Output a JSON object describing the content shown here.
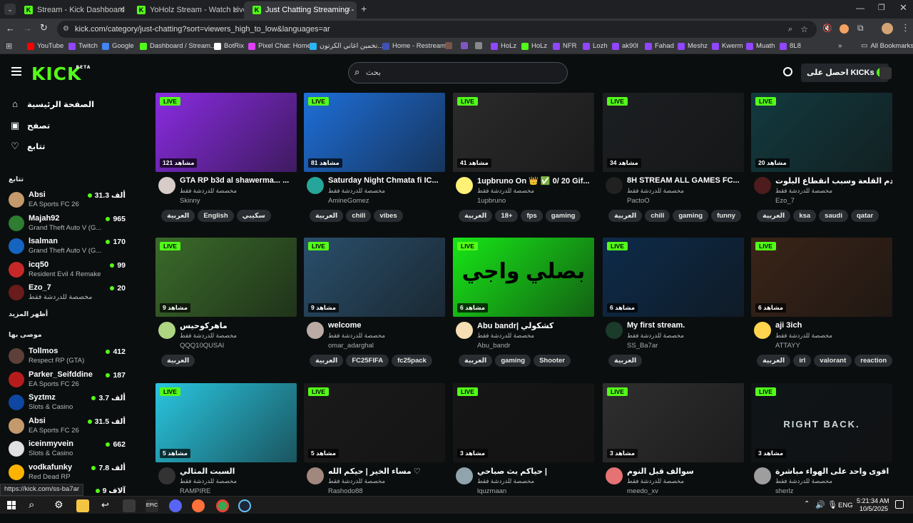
{
  "browser": {
    "tabs": [
      {
        "title": "Stream - Kick Dashboard"
      },
      {
        "title": "YoHolz Stream - Watch Live on"
      },
      {
        "title": "Just Chatting Streaming - Live"
      }
    ],
    "url": "kick.com/category/just-chatting?sort=viewers_high_to_low&languages=ar",
    "bookmarks": [
      {
        "label": "YouTube",
        "color": "#ff0000"
      },
      {
        "label": "Twitch",
        "color": "#9146ff"
      },
      {
        "label": "Google",
        "color": "#4285f4"
      },
      {
        "label": "Dashboard / Stream...",
        "color": "#53fc18"
      },
      {
        "label": "BotRix",
        "color": "#ffffff"
      },
      {
        "label": "Pixel Chat: Home",
        "color": "#e040fb"
      },
      {
        "label": "تخمين اغاني الكرتون...",
        "color": "#29b6f6"
      },
      {
        "label": "Home - Restream",
        "color": "#3f51b5"
      },
      {
        "label": "",
        "color": "#795548"
      },
      {
        "label": "",
        "color": "#7e57c2"
      },
      {
        "label": "",
        "color": "#888888"
      },
      {
        "label": "HoLz",
        "color": "#9146ff"
      },
      {
        "label": "HoLz",
        "color": "#53fc18"
      },
      {
        "label": "NFR",
        "color": "#9146ff"
      },
      {
        "label": "Lozh",
        "color": "#9146ff"
      },
      {
        "label": "ak90l",
        "color": "#9146ff"
      },
      {
        "label": "Fahad",
        "color": "#9146ff"
      },
      {
        "label": "Meshz",
        "color": "#9146ff"
      },
      {
        "label": "Kwerm",
        "color": "#9146ff"
      },
      {
        "label": "Muath",
        "color": "#9146ff"
      },
      {
        "label": "8L8",
        "color": "#9146ff"
      }
    ],
    "all_bookmarks": "All Bookmarks",
    "status_url": "https://kick.com/ss-ba7ar"
  },
  "header": {
    "logo": "KICK",
    "logo_beta": "BETA",
    "search_placeholder": "بحث",
    "get_kicks": "احصل على KICKs"
  },
  "sidebar": {
    "nav": [
      {
        "label": "الصفحة الرئيسية",
        "icon": "home-icon"
      },
      {
        "label": "تصفح",
        "icon": "browse-icon"
      },
      {
        "label": "تتابع",
        "icon": "heart-icon"
      }
    ],
    "following_title": "تتابع",
    "following": [
      {
        "name": "Absi",
        "category": "EA Sports FC 26",
        "viewers": "31.3 ألف",
        "color": "#c49a6c"
      },
      {
        "name": "Majah92",
        "category": "Grand Theft Auto V (G...",
        "viewers": "965",
        "color": "#2e7d32"
      },
      {
        "name": "lsalman",
        "category": "Grand Theft Auto V (G...",
        "viewers": "170",
        "color": "#1565c0"
      },
      {
        "name": "icq50",
        "category": "Resident Evil 4 Remake",
        "viewers": "99",
        "color": "#c62828"
      },
      {
        "name": "Ezo_7",
        "category": "مخصصة للدردشة فقط",
        "viewers": "20",
        "color": "#6a1b1b"
      }
    ],
    "show_more": "أظهر المزيد",
    "recommended_title": "موصى بها",
    "recommended": [
      {
        "name": "Tollmos",
        "category": "Respect RP (GTA)",
        "viewers": "412",
        "color": "#5d4037"
      },
      {
        "name": "Parker_Seifddine",
        "category": "EA Sports FC 26",
        "viewers": "187",
        "color": "#b71c1c"
      },
      {
        "name": "Syztmz",
        "category": "Slots & Casino",
        "viewers": "3.7 ألف",
        "color": "#0d47a1"
      },
      {
        "name": "Absi",
        "category": "EA Sports FC 26",
        "viewers": "31.5 ألف",
        "color": "#c49a6c"
      },
      {
        "name": "iceinmyvein",
        "category": "Slots & Casino",
        "viewers": "662",
        "color": "#e0e0e0"
      },
      {
        "name": "vodkafunky",
        "category": "Red Dead RP",
        "viewers": "7.8 ألف",
        "color": "#ffb300"
      },
      {
        "name": "ri",
        "category": "",
        "viewers": "9 آلاف",
        "color": "#444444"
      }
    ]
  },
  "cards": [
    {
      "live": "LIVE",
      "viewers": "121 مشاهد",
      "title": "GTA RP b3d al shawerma... ...",
      "category": "مخصصة للدردشة فقط",
      "user": "Skinny",
      "tags": [
        "العربية",
        "English",
        "سكيبي"
      ],
      "thumb": "#8a2be2",
      "avatar": "#d7ccc8"
    },
    {
      "live": "LIVE",
      "viewers": "81 مشاهد",
      "title": "Saturday Night Chmata fi IC...",
      "category": "مخصصة للدردشة فقط",
      "user": "AmineGomez",
      "tags": [
        "العربية",
        "chill",
        "vibes"
      ],
      "thumb": "#1e6fd9",
      "avatar": "#26a69a"
    },
    {
      "live": "LIVE",
      "viewers": "41 مشاهد",
      "title": "1upbruno On 👑 ✅ 0/ 20 Gif...",
      "category": "مخصصة للدردشة فقط",
      "user": "1upbruno",
      "tags": [
        "العربية",
        "18+",
        "fps",
        "gaming"
      ],
      "thumb": "#2b2b2b",
      "avatar": "#fff176"
    },
    {
      "live": "LIVE",
      "viewers": "34 مشاهد",
      "title": "8H STREAM ALL GAMES FC...",
      "category": "مخصصة للدردشة فقط",
      "user": "PactoO",
      "tags": [
        "العربية",
        "chill",
        "gaming",
        "funny"
      ],
      "thumb": "#1c1f22",
      "avatar": "#212121"
    },
    {
      "live": "LIVE",
      "viewers": "20 مشاهد",
      "title": "حقيقة هدم القلعة وسبب انقطاع البلوت",
      "category": "مخصصة للدردشة فقط",
      "user": "Ezo_7",
      "tags": [
        "العربية",
        "ksa",
        "saudi",
        "qatar"
      ],
      "thumb": "#123a3f",
      "avatar": "#4e1c1c"
    },
    {
      "live": "LIVE",
      "viewers": "9 مشاهد",
      "title": "ماهركوحيس",
      "category": "مخصصة للدردشة فقط",
      "user": "QQQ10QUSAI",
      "tags": [
        "العربية"
      ],
      "thumb": "#3a6b2a",
      "avatar": "#aed581"
    },
    {
      "live": "LIVE",
      "viewers": "9 مشاهد",
      "title": "welcome",
      "category": "مخصصة للدردشة فقط",
      "user": "omar_adarghal",
      "tags": [
        "العربية",
        "FC25FIFA",
        "fc25pack"
      ],
      "thumb": "#2a4f6b",
      "avatar": "#bcaaa4"
    },
    {
      "live": "LIVE",
      "viewers": "6 مشاهد",
      "title": "Abu bandr| كشكولي",
      "category": "مخصصة للدردشة فقط",
      "user": "Abu_bandr",
      "tags": [
        "العربية",
        "gaming",
        "Shooter"
      ],
      "thumb": "#17e617",
      "avatar": "#f5deb3",
      "thumb_text": "بصلي واجي"
    },
    {
      "live": "LIVE",
      "viewers": "6 مشاهد",
      "title": "My first stream.",
      "category": "مخصصة للدردشة فقط",
      "user": "SS_Ba7ar",
      "tags": [
        "العربية"
      ],
      "thumb": "#0d2b4a",
      "avatar": "#1b3b2b"
    },
    {
      "live": "LIVE",
      "viewers": "6 مشاهد",
      "title": "aji 3ich",
      "category": "مخصصة للدردشة فقط",
      "user": "ATTAYY",
      "tags": [
        "العربية",
        "irl",
        "valorant",
        "reaction"
      ],
      "thumb": "#3a2418",
      "avatar": "#ffd54f"
    },
    {
      "live": "LIVE",
      "viewers": "5 مشاهد",
      "title": "السبت المثالي",
      "category": "مخصصة للدردشة فقط",
      "user": "RAMPIRE",
      "tags": [],
      "thumb": "#29c6e0",
      "avatar": "#333333"
    },
    {
      "live": "LIVE",
      "viewers": "5 مشاهد",
      "title": "مساء الخير | حيكم الله ♡",
      "category": "مخصصة للدردشة فقط",
      "user": "Rashodo88",
      "tags": [],
      "thumb": "#1a1a1a",
      "avatar": "#a1887f"
    },
    {
      "live": "LIVE",
      "viewers": "3 مشاهد",
      "title": "حياكم بث صباحي |",
      "category": "مخصصة للدردشة فقط",
      "user": "lquzmaan",
      "tags": [],
      "thumb": "#161616",
      "avatar": "#90a4ae"
    },
    {
      "live": "LIVE",
      "viewers": "3 مشاهد",
      "title": "سوالف قبل النوم",
      "category": "مخصصة للدردشة فقط",
      "user": "meedo_xv",
      "tags": [],
      "thumb": "#2f2f2f",
      "avatar": "#e57373"
    },
    {
      "live": "LIVE",
      "viewers": "3 مشاهد",
      "title": "اقوى واحد على الهواء مباشرة",
      "category": "مخصصة للدردشة فقط",
      "user": "sherlz",
      "tags": [],
      "thumb": "#0f1418",
      "avatar": "#9e9e9e",
      "thumb_text": "RIGHT BACK."
    }
  ],
  "taskbar": {
    "time": "5:21:34 AM",
    "date": "10/5/2025",
    "lang": "ENG"
  }
}
